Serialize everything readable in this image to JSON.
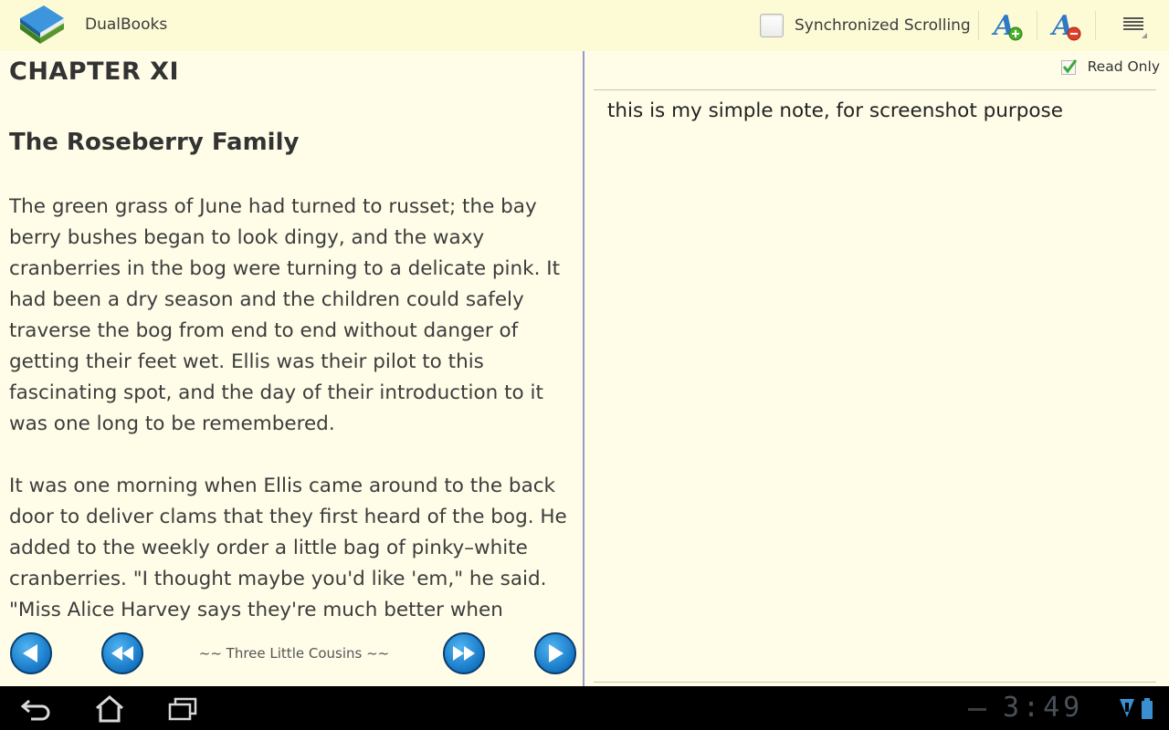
{
  "app": {
    "title": "DualBooks",
    "icon": "books-icon"
  },
  "actionbar": {
    "sync_label": "Synchronized Scrolling",
    "sync_checked": false,
    "font_increase_icon": "font-increase-icon",
    "font_decrease_icon": "font-decrease-icon",
    "menu_icon": "overflow-menu-icon"
  },
  "reader": {
    "chapter": "CHAPTER XI",
    "subtitle": "The Roseberry Family",
    "paragraphs": [
      "The green grass of June had turned to russet; the bay berry bushes began to look dingy, and the waxy cranberries in the bog were turning to a delicate pink. It had been a dry season and the children could safely traverse the bog from end to end without danger of getting their feet wet. Ellis was their pilot to this fascinating spot, and the day of their introduction to it was one long to be remembered.",
      "It was one morning when Ellis came around to the back door to deliver clams that they first heard of the bog. He added to the weekly order a little bag of pinky–white cranberries. \"I thought maybe you'd like 'em,\" he said. \"Miss Alice Harvey says they're much better when they're"
    ],
    "book_name": "~~ Three Little Cousins ~~"
  },
  "notes": {
    "read_only_label": "Read Only",
    "read_only_checked": true,
    "text": "this is my simple note, for screenshot purpose"
  },
  "system": {
    "clock": "3:49",
    "back_icon": "back-icon",
    "home_icon": "home-icon",
    "recents_icon": "recent-apps-icon"
  },
  "colors": {
    "background": "#fffde8",
    "actionbar": "#fdfbd5",
    "accent_blue": "#1576c4",
    "divider": "#9a9ac8"
  }
}
